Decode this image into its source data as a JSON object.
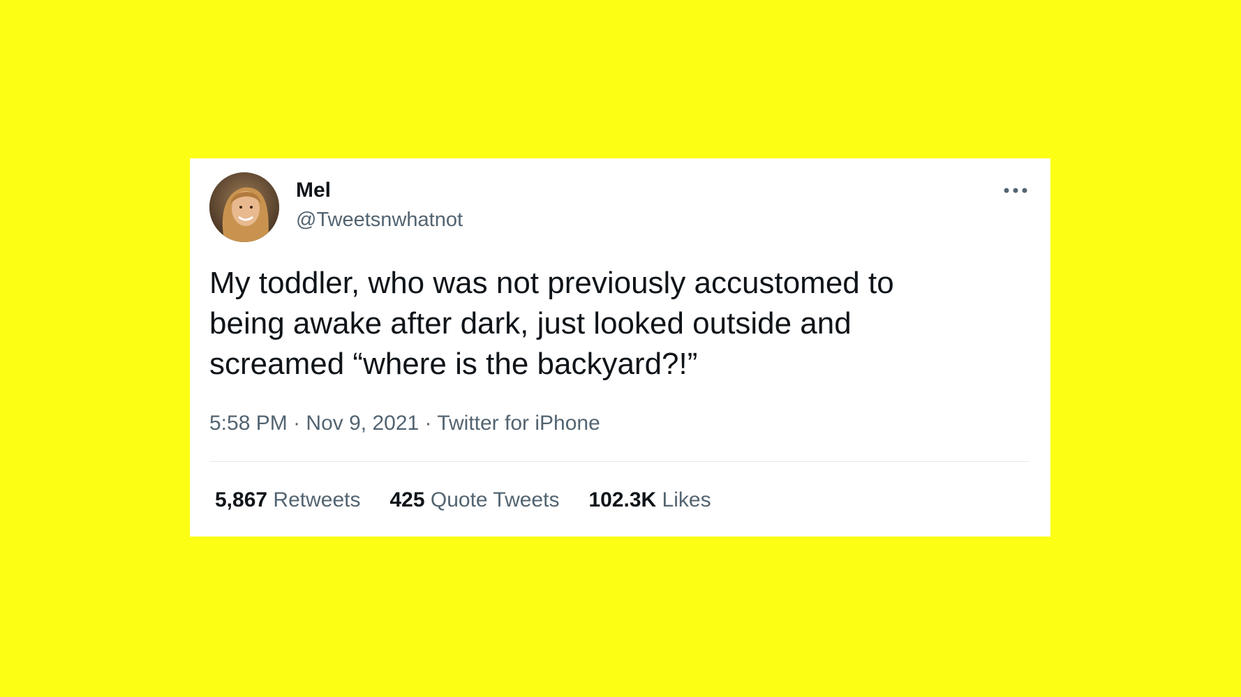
{
  "colors": {
    "background": "#fcff13",
    "card": "#ffffff",
    "text_primary": "#0f1419",
    "text_secondary": "#536471"
  },
  "author": {
    "name": "Mel",
    "handle": "@Tweetsnwhatnot",
    "avatar_icon": "avatar-photo"
  },
  "more_icon": "more-options-icon",
  "tweet": {
    "text": "My toddler, who was not previously accustomed to\nbeing awake after dark, just looked outside and\nscreamed “where is the backyard?!”",
    "time": "5:58 PM",
    "date": "Nov 9, 2021",
    "source": "Twitter for iPhone",
    "separator": " · "
  },
  "stats": [
    {
      "count": "5,867",
      "label": "Retweets"
    },
    {
      "count": "425",
      "label": "Quote Tweets"
    },
    {
      "count": "102.3K",
      "label": "Likes"
    }
  ]
}
